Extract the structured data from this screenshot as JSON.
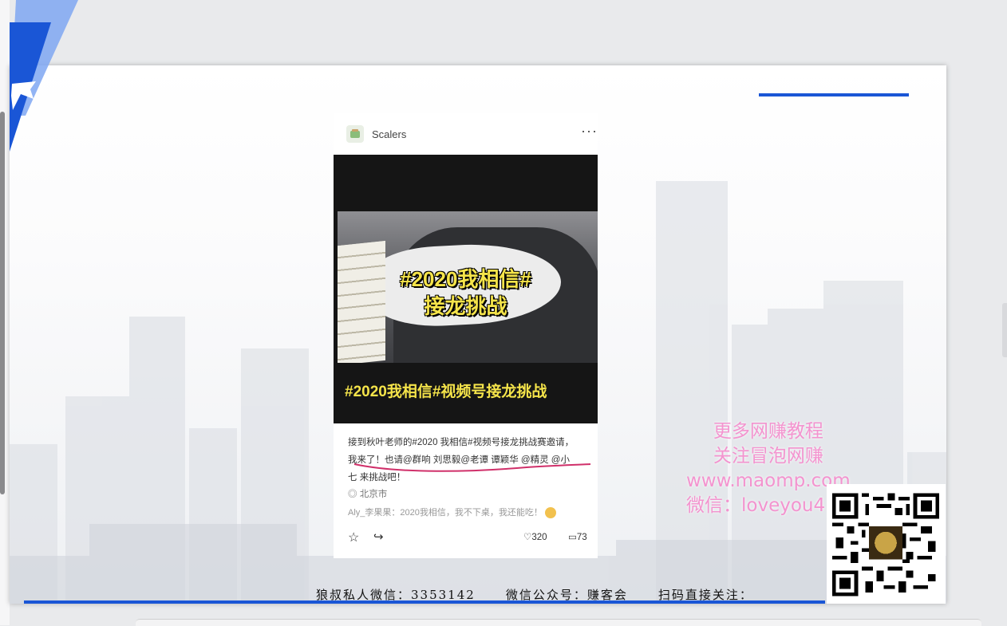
{
  "phone": {
    "account_name": "Scalers",
    "more_label": "···",
    "video_title_line1": "#2020我相信#",
    "video_title_line2": "接龙挑战",
    "video_caption": "#2020我相信#视频号接龙挑战",
    "body_line1": "接到秋叶老师的#2020 我相信#视频号接龙挑战赛邀请，",
    "body_line2": "我来了！也请@群响 刘思毅@老谭 谭颖华 @精灵 @小",
    "body_line3": "七 来挑战吧！",
    "location": "北京市",
    "comment": "Aly_李果果：2020我相信，我不下桌，我还能吃！",
    "likes": "320",
    "comments": "73"
  },
  "watermark": {
    "line1": "更多网赚教程",
    "line2": "关注冒泡网赚",
    "line3": "www.maomp.com",
    "line4": "微信：loveyou4"
  },
  "footer": {
    "wechat_private": "狼叔私人微信：3353142",
    "official_account": "微信公众号：赚客会",
    "scan": "扫码直接关注："
  },
  "colors": {
    "accent": "#1a56d6",
    "watermark": "#f382c8",
    "caption": "#f5e44a"
  }
}
